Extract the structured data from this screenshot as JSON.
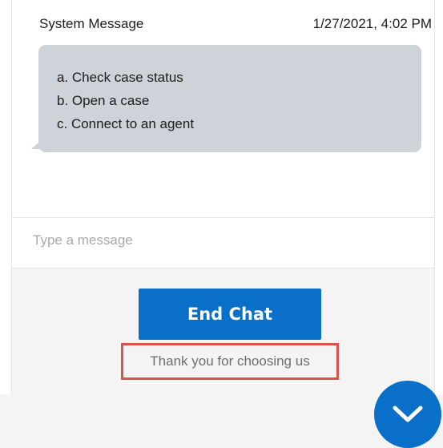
{
  "message": {
    "sender": "System Message",
    "timestamp": "1/27/2021, 4:02 PM",
    "options": [
      "a. Check case status",
      "b. Open a case",
      "c. Connect to an agent"
    ]
  },
  "composer": {
    "placeholder": "Type a message"
  },
  "footer": {
    "end_chat_label": "End Chat",
    "thanks_text": "Thank you for choosing us"
  },
  "colors": {
    "accent": "#0a6fc9",
    "bubble": "#cdd3d8",
    "highlight_border": "#d9534a"
  },
  "icons": {
    "scroll_button": "chevron-down-icon"
  }
}
